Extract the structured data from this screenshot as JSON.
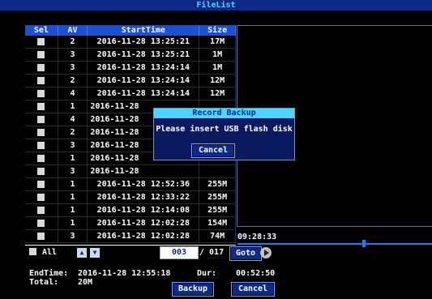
{
  "title": "FileList",
  "table": {
    "headers": [
      "Sel",
      "AV",
      "StartTime",
      "Size"
    ],
    "rows": [
      {
        "av": "2",
        "start": "2016-11-28 13:25:21",
        "size": "17M"
      },
      {
        "av": "3",
        "start": "2016-11-28 13:25:21",
        "size": "1M"
      },
      {
        "av": "3",
        "start": "2016-11-28 13:24:14",
        "size": "1M"
      },
      {
        "av": "2",
        "start": "2016-11-28 13:24:14",
        "size": "12M"
      },
      {
        "av": "4",
        "start": "2016-11-28 13:24:14",
        "size": "12M"
      },
      {
        "av": "1",
        "start": "2016-11-28",
        "size": ""
      },
      {
        "av": "4",
        "start": "2016-11-28",
        "size": ""
      },
      {
        "av": "2",
        "start": "2016-11-28",
        "size": ""
      },
      {
        "av": "3",
        "start": "2016-11-28",
        "size": ""
      },
      {
        "av": "1",
        "start": "2016-11-28",
        "size": ""
      },
      {
        "av": "3",
        "start": "2016-11-28",
        "size": ""
      },
      {
        "av": "1",
        "start": "2016-11-28 12:52:36",
        "size": "255M"
      },
      {
        "av": "1",
        "start": "2016-11-28 12:33:22",
        "size": "255M"
      },
      {
        "av": "1",
        "start": "2016-11-28 12:14:08",
        "size": "255M"
      },
      {
        "av": "1",
        "start": "2016-11-28 12:02:28",
        "size": "154M"
      },
      {
        "av": "3",
        "start": "2016-11-28 12:02:28",
        "size": "74M"
      }
    ]
  },
  "timeline": {
    "time": "09:28:33",
    "position_fraction": 0.64
  },
  "controls": {
    "all_label": "All",
    "page_current": "003",
    "page_total": "/ 017",
    "goto_label": "Goto",
    "up_icon": "arrow-up-icon",
    "down_icon": "arrow-down-icon",
    "play_icon": "play-icon"
  },
  "info": {
    "endtime_label": "EndTime:",
    "endtime_value": "2016-11-28 12:55:18",
    "dur_label": "Dur:",
    "dur_value": "00:52:50",
    "total_label": "Total:",
    "total_value": "20M"
  },
  "buttons": {
    "backup": "Backup",
    "cancel": "Cancel"
  },
  "dialog": {
    "title": "Record Backup",
    "message": "Please insert USB flash disk",
    "cancel": "Cancel"
  },
  "colors": {
    "header_blue": "#1a4fd8",
    "title_cyan": "#4fd4ff",
    "timeline_blue": "#1e7bff"
  }
}
